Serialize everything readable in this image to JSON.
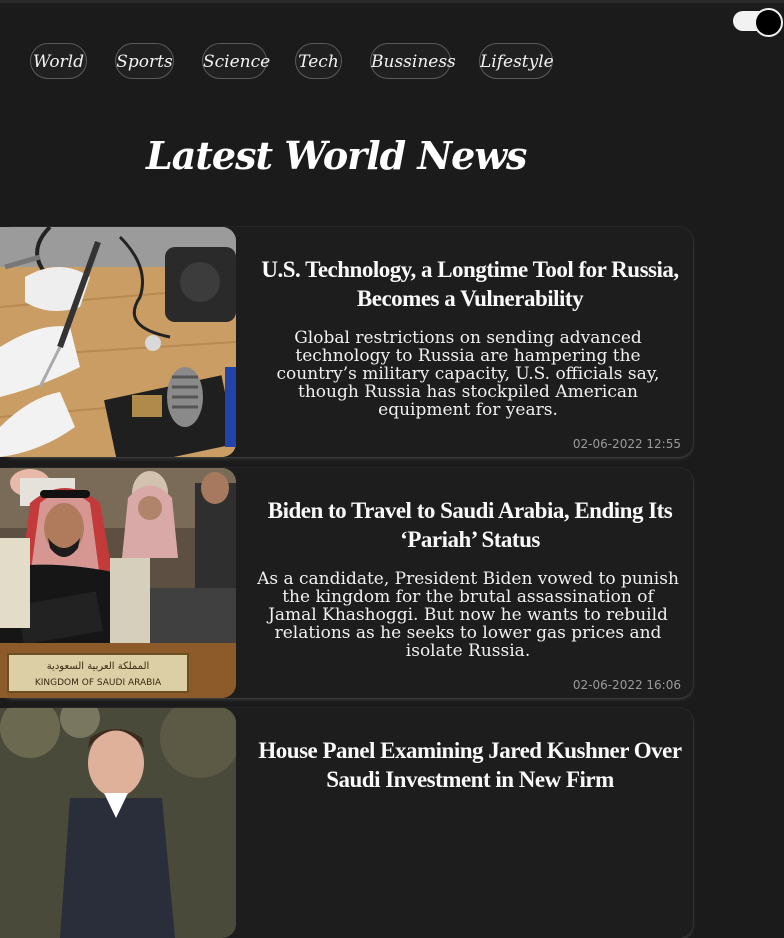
{
  "nav": {
    "items": [
      "World",
      "Sports",
      "Science",
      "Tech",
      "Bussiness",
      "Lifestyle"
    ]
  },
  "page": {
    "heading": "Latest World News"
  },
  "theme_toggle": {
    "state": "dark"
  },
  "articles": [
    {
      "title": "U.S. Technology, a Longtime Tool for Russia, Becomes a Vulnerability",
      "description": "Global restrictions on sending advanced technology to Russia are hampering the country’s military capacity, U.S. officials say, though Russia has stockpiled American equipment for years.",
      "timestamp": "02-06-2022 12:55"
    },
    {
      "title": "Biden to Travel to Saudi Arabia, Ending Its ‘Pariah’ Status",
      "description": "As a candidate, President Biden vowed to punish the kingdom for the brutal assassination of Jamal Khashoggi. But now he wants to rebuild relations as he seeks to lower gas prices and isolate Russia.",
      "timestamp": "02-06-2022 16:06"
    },
    {
      "title": "House Panel Examining Jared Kushner Over Saudi Investment in New Firm",
      "description": "",
      "timestamp": ""
    }
  ],
  "image_signs": {
    "kingdom_en": "KINGDOM OF SAUDI ARABIA"
  },
  "colors": {
    "background": "#1b1b1b",
    "card": "#1d1d1d",
    "text": "#f4f4f4",
    "muted": "#9a9a9a"
  }
}
